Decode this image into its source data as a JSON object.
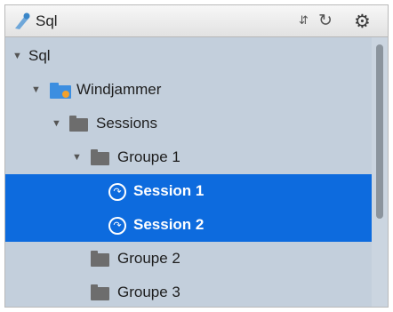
{
  "header": {
    "title": "Sql",
    "app_icon": "sql-drop-icon",
    "sort_icon": "sort-updown-icon",
    "refresh_icon": "refresh-icon",
    "settings_icon": "gear-icon"
  },
  "tree": {
    "root": "Sql",
    "database": "Windjammer",
    "sessions_folder": "Sessions",
    "group1": "Groupe 1",
    "session1": "Session 1",
    "session2": "Session 2",
    "group2": "Groupe 2",
    "group3": "Groupe 3"
  },
  "colors": {
    "selection": "#0d6bde",
    "tree_background": "#c3cfdc"
  }
}
